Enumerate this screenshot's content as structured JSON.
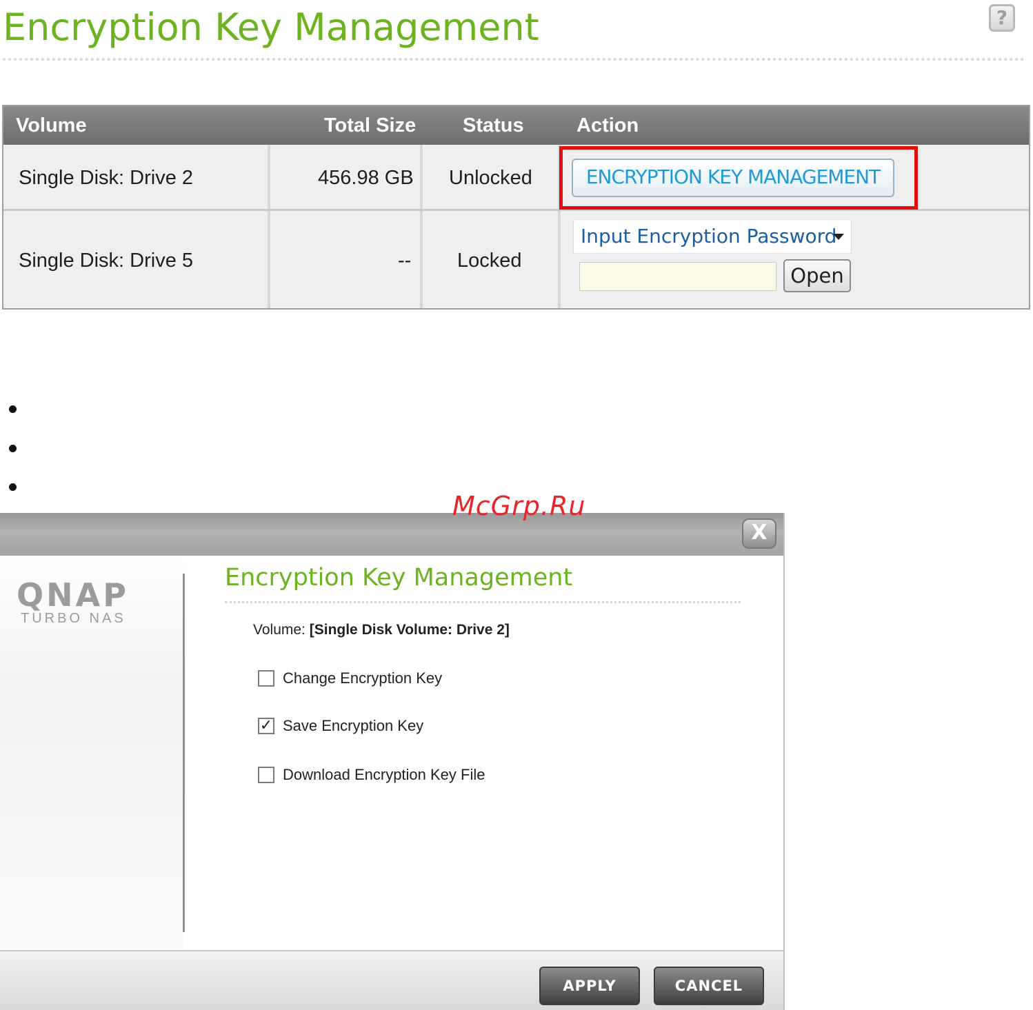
{
  "page": {
    "title": "Encryption Key Management",
    "help_icon": "?"
  },
  "table": {
    "headers": [
      "Volume",
      "Total Size",
      "Status",
      "Action"
    ],
    "rows": [
      {
        "volume": "Single Disk: Drive 2",
        "total_size": "456.98 GB",
        "status": "Unlocked",
        "action_button": "ENCRYPTION KEY MANAGEMENT"
      },
      {
        "volume": "Single Disk: Drive 5",
        "total_size": "--",
        "status": "Locked",
        "action_select": "Input Encryption Password",
        "action_input_value": "",
        "action_open": "Open"
      }
    ]
  },
  "watermark": "McGrp.Ru",
  "dialog": {
    "close_label": "X",
    "logo_main": "QNAP",
    "logo_sub": "TURBO NAS",
    "heading": "Encryption Key Management",
    "volume_label": "Volume:",
    "volume_value": "[Single Disk Volume: Drive 2]",
    "options": [
      {
        "label": "Change Encryption Key",
        "checked": false
      },
      {
        "label": "Save Encryption Key",
        "checked": true
      },
      {
        "label": "Download Encryption Key File",
        "checked": false
      }
    ],
    "apply_label": "APPLY",
    "cancel_label": "CANCEL"
  },
  "colors": {
    "title_green": "#6cb31f",
    "highlight_red": "#e01010",
    "link_blue": "#1e9ad6",
    "header_gray": "#7a7a7a"
  }
}
